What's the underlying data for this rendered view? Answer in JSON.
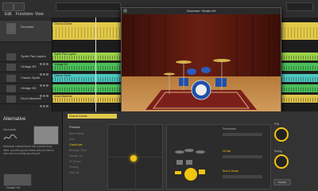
{
  "app": {
    "toolbar_items": [
      "Edit",
      "Functions",
      "View"
    ]
  },
  "tracks": [
    {
      "name": "Drummer"
    },
    {
      "name": "Synth Pad Layers"
    },
    {
      "name": "Vintage B3"
    },
    {
      "name": "Classic Synth"
    },
    {
      "name": "Vintage B3"
    },
    {
      "name": "Drum Machine"
    }
  ],
  "regions": {
    "drums_label": "Chorus Drums",
    "synth_pad_label": "Synth Pad Layers",
    "vintage_label": "Vintage B3",
    "classic_label": "Classic Synth",
    "drum_machine_label": "Drum Machine"
  },
  "plugin": {
    "title": "Drummer: Studio Kit",
    "designer_label": "Drum Kit Designer"
  },
  "drummer_panel": {
    "section_title": "Alternative",
    "drummer_label": "Drummer",
    "bio": "Aleksandr cranked that it has a punk's busy riffed, a perfect groove blasts with all what he ever has on a pretty sounding kit",
    "kit_label": "Studio Kit"
  },
  "drum_editor": {
    "region_header": "Chorus Drums",
    "presets_label": "Presets",
    "presets": [
      "Beat Wallop",
      "Chill",
      "Grand Ave",
      "Brooklyn Roof",
      "Steady Go",
      "Hi Tempo",
      "Feeling",
      "Slap Up"
    ],
    "selected_preset_index": 3,
    "follow_label": "Follow",
    "details_label": "Details",
    "swing_label": "Swing",
    "percussion_label": "Percussion",
    "hihat_label": "Hi-Hat",
    "kick_snare_label": "Kick & Snare",
    "knob_fill_label": "Fills"
  },
  "colors": {
    "drummer_region": "#e2c94a",
    "synth_region": "#9bd24a",
    "vintage_region": "#4bbf5a",
    "classic_region": "#4cc7c0",
    "drum_machine_region": "#e0c54a",
    "accent_yellow": "#f1c40f"
  }
}
